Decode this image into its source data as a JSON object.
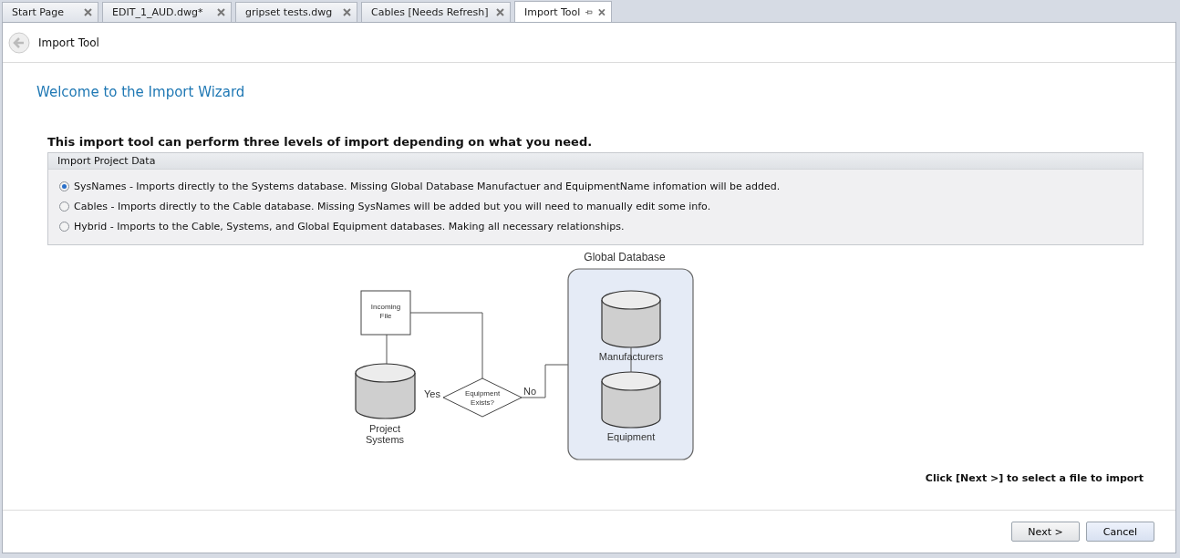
{
  "tabs": [
    {
      "label": "Start Page",
      "selected": false
    },
    {
      "label": "EDIT_1_AUD.dwg*",
      "selected": false
    },
    {
      "label": "gripset tests.dwg",
      "selected": false
    },
    {
      "label": "Cables [Needs Refresh]",
      "selected": false
    },
    {
      "label": "Import Tool",
      "selected": true
    }
  ],
  "page_header": {
    "title": "Import Tool"
  },
  "wizard_title": "Welcome to the Import Wizard",
  "intro": "This import tool can perform three levels of import depending on what you need.",
  "group": {
    "title": "Import Project Data",
    "options": [
      {
        "label": "SysNames - Imports directly to the Systems database. Missing Global Database Manufactuer and EquipmentName infomation will be added.",
        "selected": true
      },
      {
        "label": "Cables - Imports directly to the Cable database. Missing SysNames will be added but you will need to manually edit some info.",
        "selected": false
      },
      {
        "label": "Hybrid - Imports to the Cable, Systems, and Global Equipment databases. Making all necessary relationships.",
        "selected": false
      }
    ]
  },
  "diagram": {
    "global_label": "Global Database",
    "incoming": [
      "Incoming",
      "File"
    ],
    "project": [
      "Project",
      "Systems"
    ],
    "decision": [
      "Equipment",
      "Exists?"
    ],
    "yes": "Yes",
    "no": "No",
    "manufacturers": "Manufacturers",
    "equipment": "Equipment"
  },
  "hint": "Click [Next >] to select a file to import",
  "buttons": [
    "Next >",
    "Cancel"
  ]
}
